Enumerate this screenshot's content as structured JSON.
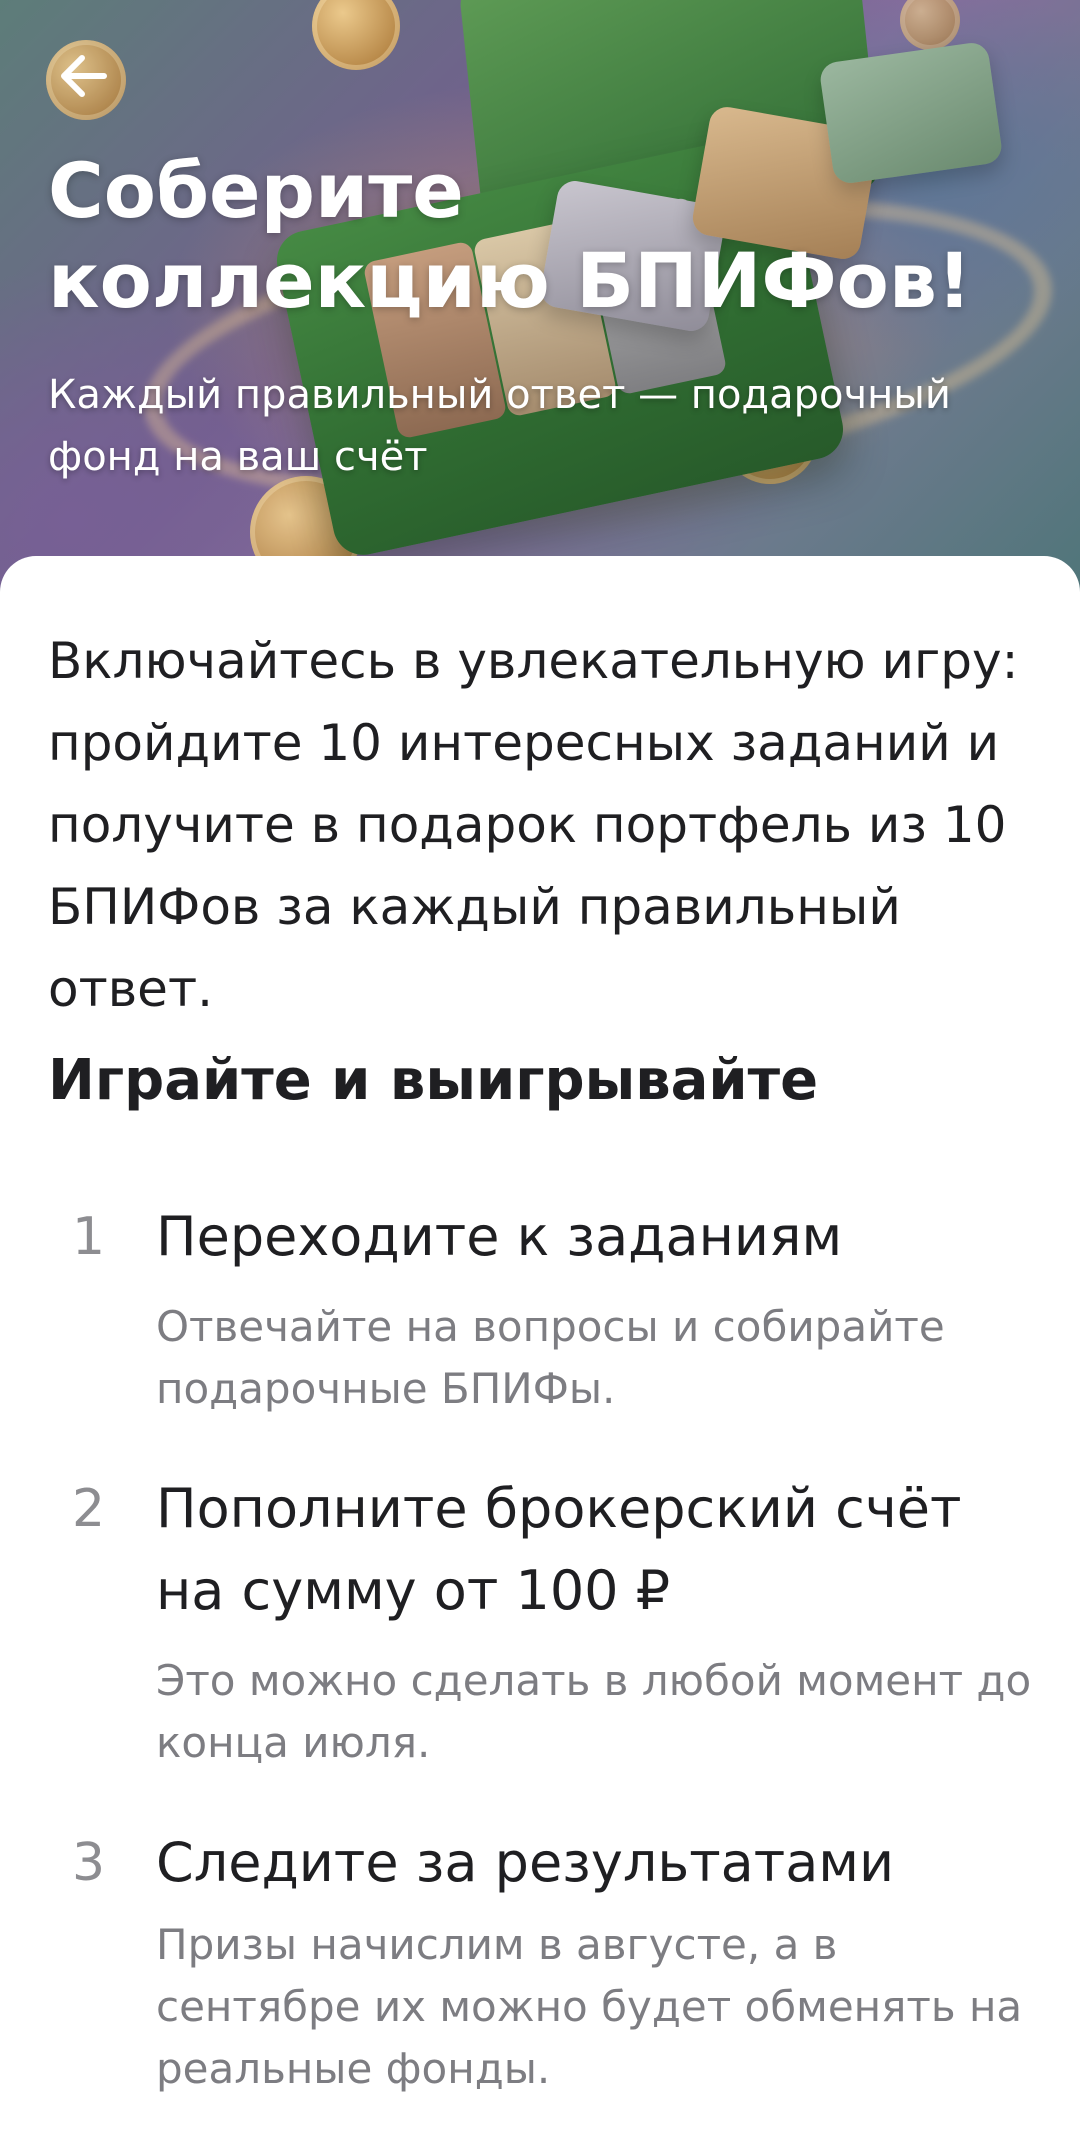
{
  "header": {
    "back_icon": "arrow-left-icon",
    "title": "Соберите коллекцию БПИФов!",
    "subtitle": "Каждый правильный ответ — подарочный фонд на ваш счёт"
  },
  "content": {
    "intro": "Включайтесь в увлекательную игру: пройдите 10 интересных заданий и получите в подарок портфель из 10 БПИФов за каждый правильный ответ.",
    "section_title": "Играйте и выигрывайте",
    "steps": [
      {
        "number": "1",
        "title": "Переходите к заданиям",
        "description": "Отвечайте на вопросы и собирайте подарочные БПИФы."
      },
      {
        "number": "2",
        "title": "Пополните брокерский счёт на сумму от 100 ₽",
        "description": "Это можно сделать в любой момент до конца июля."
      },
      {
        "number": "3",
        "title": "Следите за результатами",
        "description": "Призы начислим в августе, а в сентябре их можно будет обменять на реальные фонды."
      }
    ]
  }
}
